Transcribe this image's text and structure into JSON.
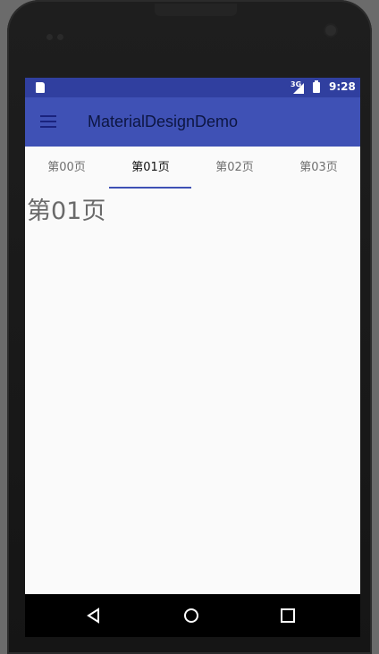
{
  "status_bar": {
    "network_label": "3G",
    "time": "9:28"
  },
  "toolbar": {
    "title": "MaterialDesignDemo",
    "menu_icon": "menu-icon"
  },
  "tabs": [
    {
      "label": "第00页",
      "active": false
    },
    {
      "label": "第01页",
      "active": true
    },
    {
      "label": "第02页",
      "active": false
    },
    {
      "label": "第03页",
      "active": false
    }
  ],
  "content": {
    "page_label": "第01页"
  },
  "navigation": {
    "back_icon": "back-icon",
    "home_icon": "home-icon",
    "recents_icon": "recents-icon"
  },
  "colors": {
    "primary": "#3f51b5",
    "primary_dark": "#303f9f",
    "accent_indicator": "#3f51b5"
  }
}
